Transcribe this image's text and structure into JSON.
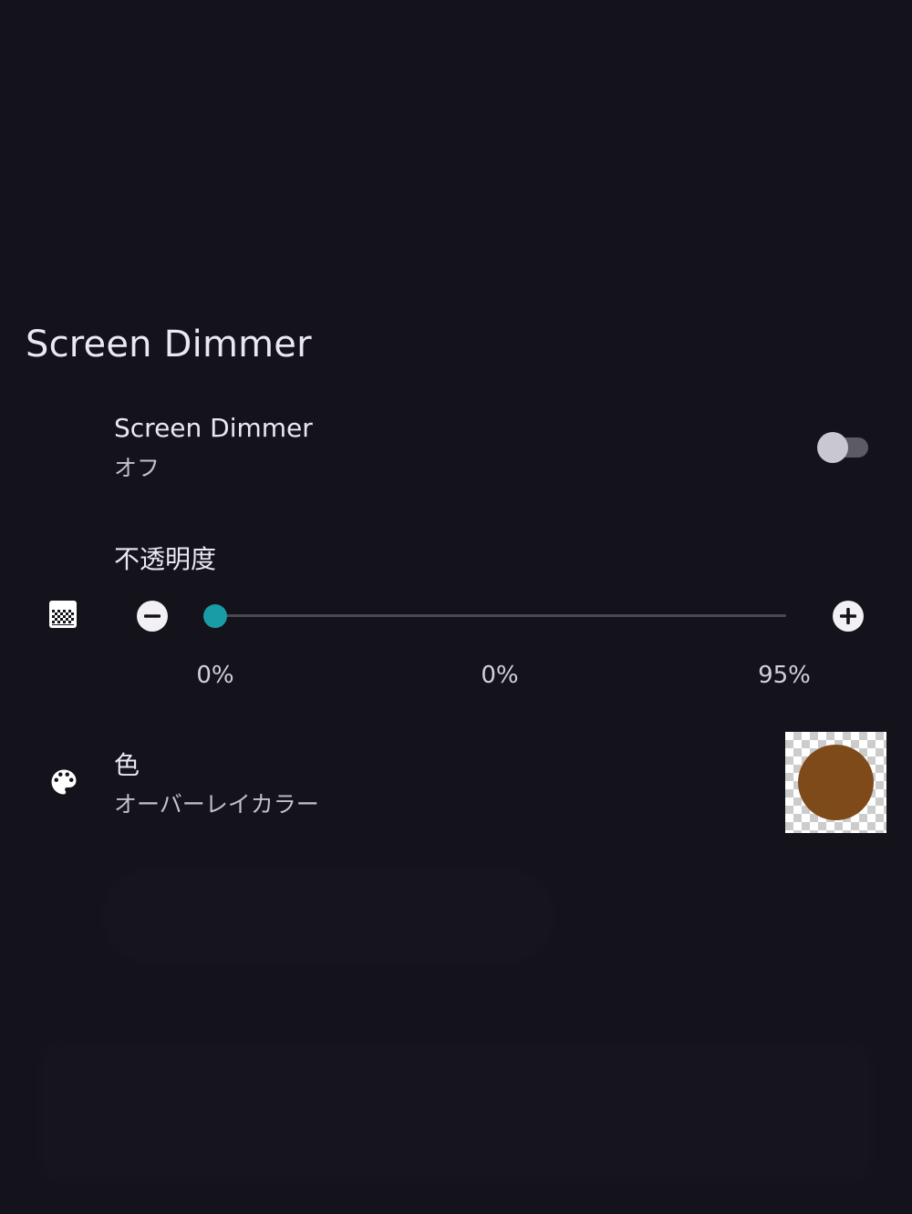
{
  "header": {
    "title": "Screen Dimmer"
  },
  "dimmer_row": {
    "title": "Screen Dimmer",
    "summary": "オフ",
    "enabled": false
  },
  "opacity_row": {
    "title": "不透明度",
    "icon": "opacity-pattern-icon",
    "decrease_icon": "minus-circle-icon",
    "increase_icon": "plus-circle-icon",
    "value_percent": 0,
    "min_label": "0%",
    "current_label": "0%",
    "max_label": "95%",
    "min": 0,
    "max": 95
  },
  "color_row": {
    "title": "色",
    "summary": "オーバーレイカラー",
    "icon": "palette-icon",
    "color": "#7e4a1a"
  },
  "colors": {
    "background": "#14121a",
    "accent": "#1a9ca6",
    "text_primary": "#ece8f2",
    "text_secondary": "#c5c0cc"
  }
}
